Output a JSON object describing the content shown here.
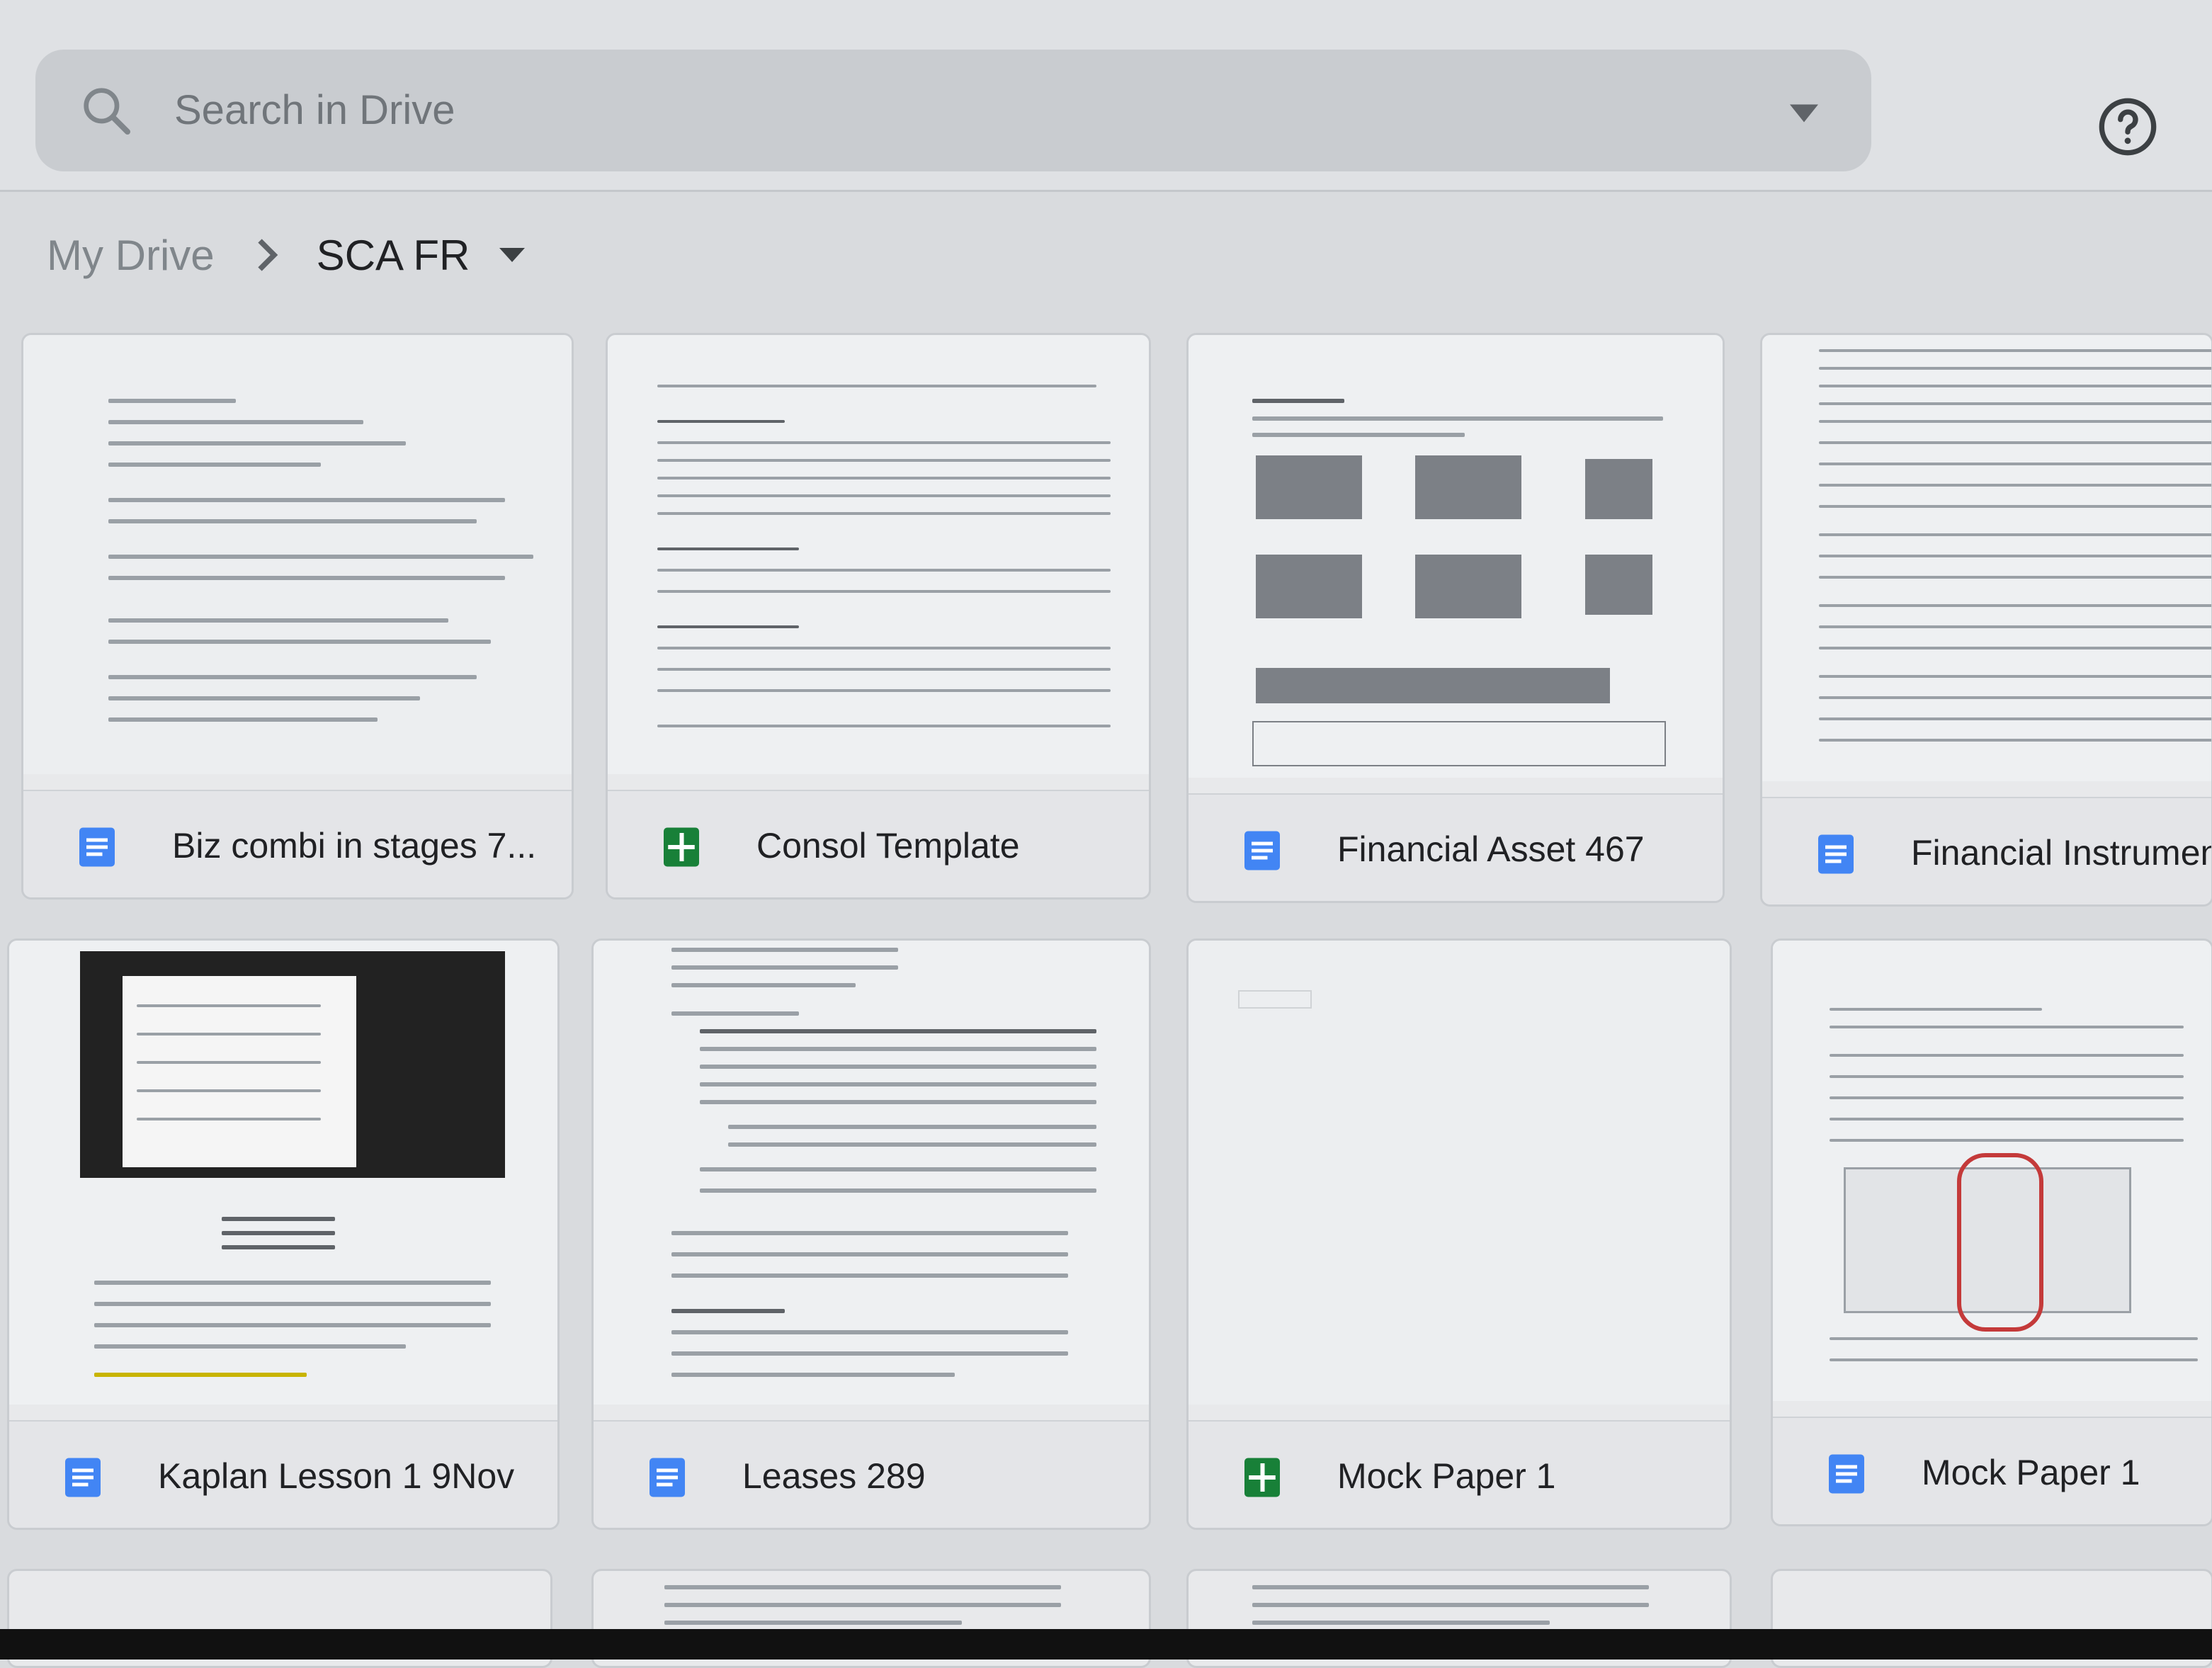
{
  "search": {
    "placeholder": "Search in Drive"
  },
  "breadcrumb": {
    "root": "My Drive",
    "current": "SCA FR"
  },
  "files": [
    {
      "name": "Biz combi in stages 7...",
      "type": "doc"
    },
    {
      "name": "Consol Template",
      "type": "sheet"
    },
    {
      "name": "Financial Asset 467",
      "type": "doc"
    },
    {
      "name": "Financial Instrument",
      "type": "doc"
    },
    {
      "name": "Kaplan Lesson 1 9Nov",
      "type": "doc"
    },
    {
      "name": "Leases 289",
      "type": "doc"
    },
    {
      "name": "Mock Paper 1",
      "type": "sheet"
    },
    {
      "name": "Mock Paper 1",
      "type": "doc"
    }
  ],
  "colors": {
    "doc": "#4285f4",
    "sheet": "#188038",
    "accent": "#1a73e8"
  }
}
